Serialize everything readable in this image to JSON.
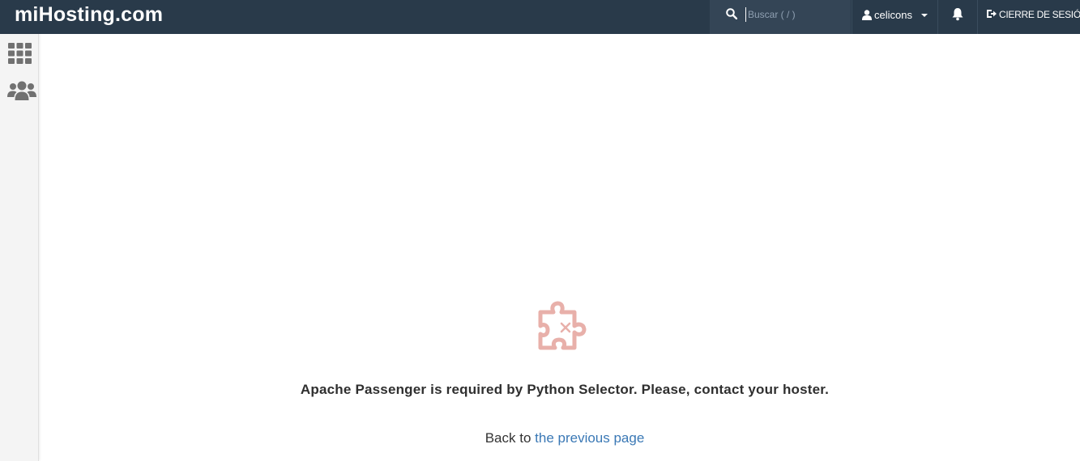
{
  "header": {
    "brand": "miHosting.com",
    "search_placeholder": "Buscar ( / )",
    "username": "celicons",
    "logout_label": "CIERRE DE SESIÓN"
  },
  "sidebar": {
    "items": [
      {
        "name": "apps-grid-icon"
      },
      {
        "name": "users-icon"
      }
    ]
  },
  "main": {
    "error_message": "Apache Passenger is required by Python Selector. Please, contact your hoster.",
    "back_prefix": "Back to",
    "back_link": "the previous page"
  },
  "colors": {
    "topbar": "#293a4a",
    "puzzle": "#e8b0aa",
    "link": "#3a78b5"
  }
}
